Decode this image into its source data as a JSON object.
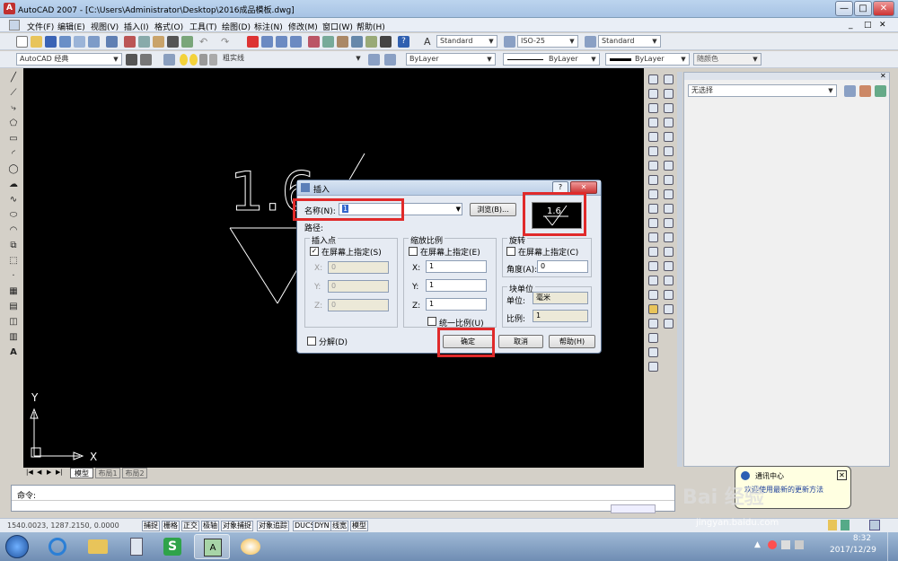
{
  "window": {
    "title": "AutoCAD 2007 - [C:\\Users\\Administrator\\Desktop\\2016成品模板.dwg]",
    "min_label": "—",
    "max_label": "□",
    "close_label": "✕"
  },
  "menu": [
    "文件(F)",
    "编辑(E)",
    "视图(V)",
    "插入(I)",
    "格式(O)",
    "工具(T)",
    "绘图(D)",
    "标注(N)",
    "修改(M)",
    "窗口(W)",
    "帮助(H)"
  ],
  "toolbar": {
    "text_style": "Standard",
    "dim_style": "ISO-25",
    "table_style": "Standard",
    "workspace": "AutoCAD 经典",
    "layer": "粗实线",
    "color": "ByLayer",
    "linetype": "ByLayer",
    "lineweight": "ByLayer",
    "plotstyle": "随颜色"
  },
  "properties_panel": {
    "selection": "无选择"
  },
  "drawing": {
    "roughness_value": "1.6",
    "ucs_x": "X",
    "ucs_y": "Y"
  },
  "layout_tabs": [
    "模型",
    "布局1",
    "布局2"
  ],
  "command": {
    "prompt": "命令:"
  },
  "status": {
    "coords": "1540.0023, 1287.2150, 0.0000",
    "buttons": [
      "捕捉",
      "栅格",
      "正交",
      "极轴",
      "对象捕捉",
      "对象追踪",
      "DUCS",
      "DYN",
      "线宽",
      "模型"
    ]
  },
  "dialog": {
    "title": "插入",
    "help_icon": "?",
    "close_icon": "✕",
    "name_label": "名称(N):",
    "name_value": "1",
    "browse_label": "浏览(B)...",
    "path_label": "路径:",
    "insert_point": {
      "heading": "插入点",
      "on_screen": "在屏幕上指定(S)",
      "checked": true,
      "x_label": "X:",
      "x_value": "0",
      "y_label": "Y:",
      "y_value": "0",
      "z_label": "Z:",
      "z_value": "0"
    },
    "scale": {
      "heading": "缩放比例",
      "on_screen": "在屏幕上指定(E)",
      "checked": false,
      "x_label": "X:",
      "x_value": "1",
      "y_label": "Y:",
      "y_value": "1",
      "z_label": "Z:",
      "z_value": "1",
      "uniform": "统一比例(U)"
    },
    "rotation": {
      "heading": "旋转",
      "on_screen": "在屏幕上指定(C)",
      "checked": false,
      "angle_label": "角度(A):",
      "angle_value": "0"
    },
    "block_unit": {
      "heading": "块单位",
      "unit_label": "单位:",
      "unit_value": "毫米",
      "scale_label": "比例:",
      "scale_value": "1"
    },
    "explode": "分解(D)",
    "ok": "确定",
    "cancel": "取消",
    "help": "帮助(H)",
    "preview_value": "1.6"
  },
  "balloon": {
    "title": "通讯中心",
    "body": "欢迎使用最新的更新方法"
  },
  "taskbar": {
    "time": "8:32",
    "date": "2017/12/29"
  },
  "watermark": {
    "brand": "Bai 经验",
    "url": "jingyan.baidu.com"
  },
  "colors": {
    "highlight": "#e02a2a",
    "canvas": "#000000",
    "dialog_bg": "#e6ebf3"
  }
}
